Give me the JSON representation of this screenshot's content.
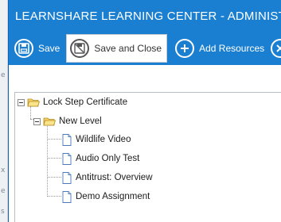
{
  "dialog": {
    "title": "LEARNSHARE LEARNING CENTER - ADMINISTER CU"
  },
  "toolbar": {
    "save_label": "Save",
    "save_close_label": "Save and Close",
    "add_resources_label": "Add Resources",
    "cancel_label": "C"
  },
  "tree": {
    "root": {
      "label": "Lock Step Certificate"
    },
    "level": {
      "label": "New Level"
    },
    "items": [
      {
        "label": "Wildlife Video"
      },
      {
        "label": "Audio Only Test"
      },
      {
        "label": "Antitrust: Overview"
      },
      {
        "label": "Demo Assignment"
      }
    ]
  },
  "background_page": {
    "marks": [
      "e",
      "x",
      "e",
      "s"
    ]
  },
  "colors": {
    "header_blue": "#1a7fd0",
    "folder_yellow": "#f5d265",
    "white": "#ffffff"
  }
}
